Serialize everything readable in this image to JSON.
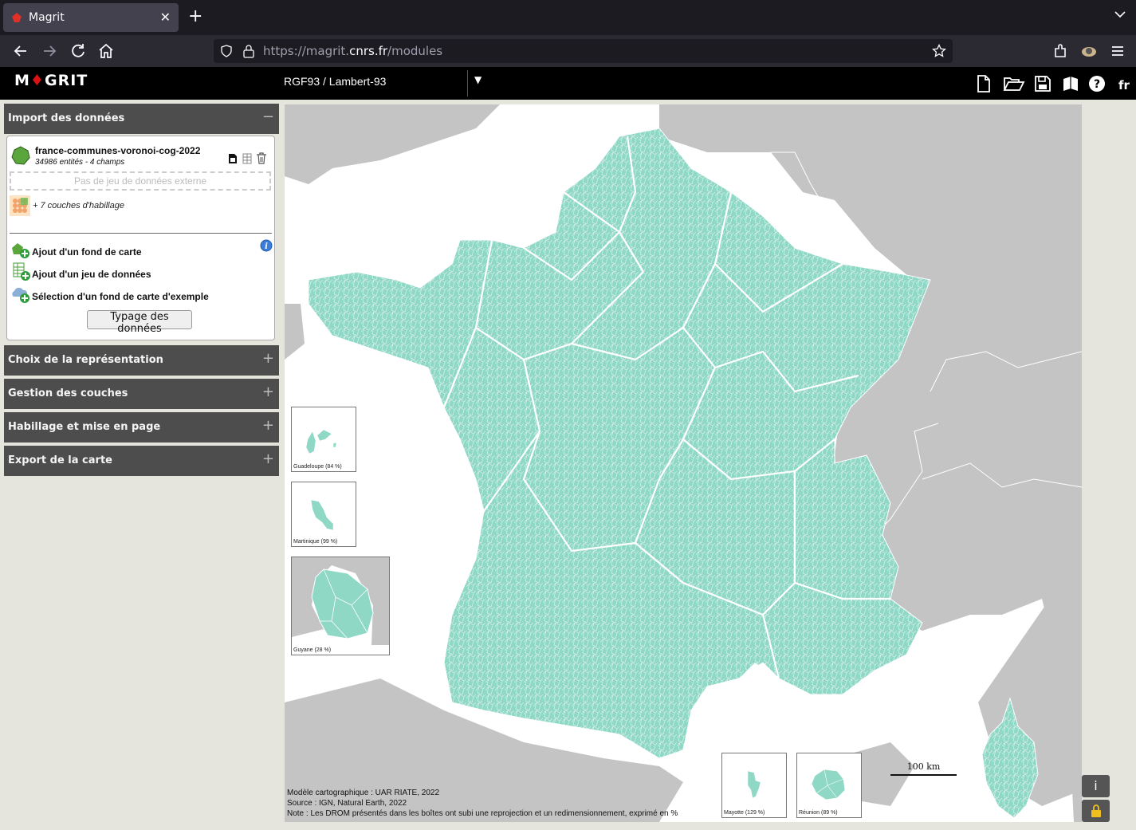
{
  "browser": {
    "tab_title": "Magrit",
    "url_prefix": "https://magrit.",
    "url_domain": "cnrs.fr",
    "url_path": "/modules"
  },
  "app": {
    "logo_before": "M",
    "logo_after": "GRIT",
    "projection": "RGF93 / Lambert-93",
    "language": "fr"
  },
  "panel": {
    "import_title": "Import des données",
    "import_toggle": "−",
    "layer_name": "france-communes-voronoi-cog-2022",
    "layer_info": "34986 entités - 4 champs",
    "external_placeholder": "Pas de jeu de données externe",
    "habillage_count": "+ 7 couches d'habillage",
    "actions": [
      {
        "label": "Ajout d'un fond de carte"
      },
      {
        "label": "Ajout d'un jeu de données"
      },
      {
        "label": "Sélection d'un fond de carte d'exemple"
      }
    ],
    "typage_button": "Typage des données",
    "sections": [
      {
        "label": "Choix de la représentation",
        "toggle": "+"
      },
      {
        "label": "Gestion des couches",
        "toggle": "+"
      },
      {
        "label": "Habillage et mise en page",
        "toggle": "+"
      },
      {
        "label": "Export de la carte",
        "toggle": "+"
      }
    ]
  },
  "map": {
    "fill_color": "#8fd8c6",
    "background_land": "#c4c4c4",
    "insets": [
      {
        "caption": "Guadeloupe (84 %)"
      },
      {
        "caption": "Martinique (99 %)"
      },
      {
        "caption": "Guyane (28 %)"
      },
      {
        "caption": "Mayotte (129 %)"
      },
      {
        "caption": "Réunion (89 %)"
      }
    ],
    "scale_label": "100 km",
    "credits": [
      "Modèle cartographique : UAR RIATE, 2022",
      "Source : IGN, Natural Earth, 2022",
      "Note : Les DROM présentés dans les boîtes ont subi une reprojection et un redimensionnement, exprimé en %"
    ],
    "info_button": "i"
  }
}
